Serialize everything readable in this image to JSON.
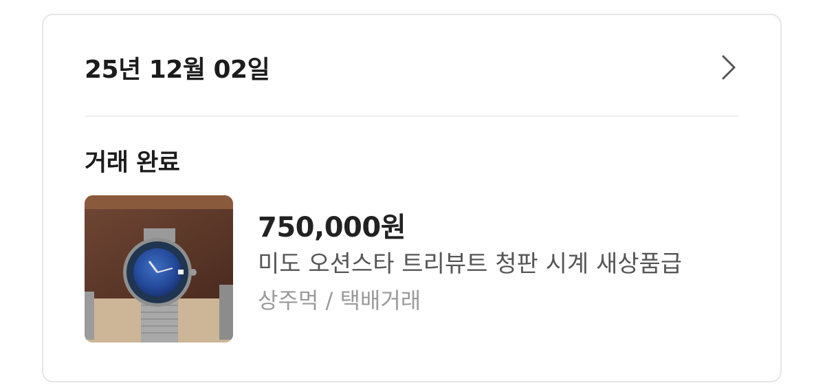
{
  "header": {
    "date": "25년 12월 02일",
    "chevron_icon": "chevron-right-icon"
  },
  "status": "거래 완료",
  "item": {
    "price": "750,000원",
    "title": "미도 오션스타 트리뷰트 청판 시계 새상품급",
    "meta": "상주먹 / 택배거래",
    "image": "watch-photo"
  },
  "colors": {
    "border": "#e6e6e6",
    "divider": "#f0f0f0",
    "title_text": "#555555",
    "meta_text": "#9a9a9a",
    "dial_blue": "#2a56a8"
  }
}
